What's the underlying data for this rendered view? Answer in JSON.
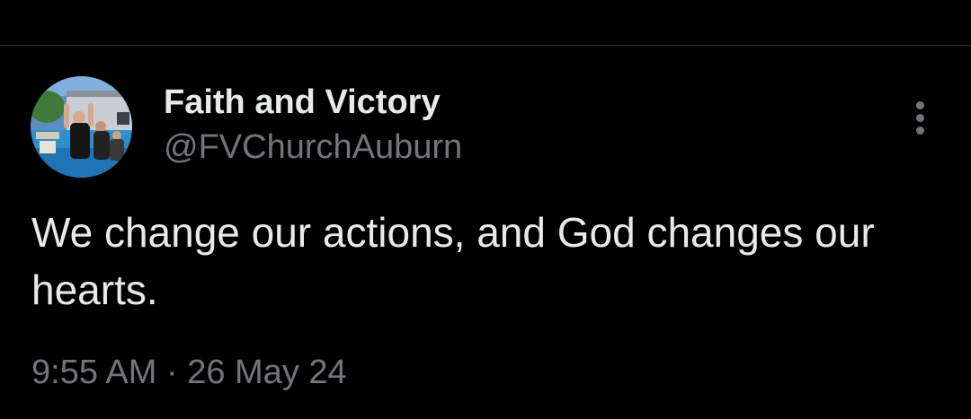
{
  "tweet": {
    "author": {
      "display_name": "Faith and Victory",
      "handle": "@FVChurchAuburn",
      "avatar_icon": "profile-photo"
    },
    "text": "We change our actions, and God changes our hearts.",
    "time": "9:55 AM",
    "separator": "·",
    "date": "26 May 24",
    "more_icon": "vertical-ellipsis-icon"
  },
  "colors": {
    "background": "#000000",
    "primary_text": "#e7e9ea",
    "secondary_text": "#71767b",
    "divider": "#2f3336"
  }
}
